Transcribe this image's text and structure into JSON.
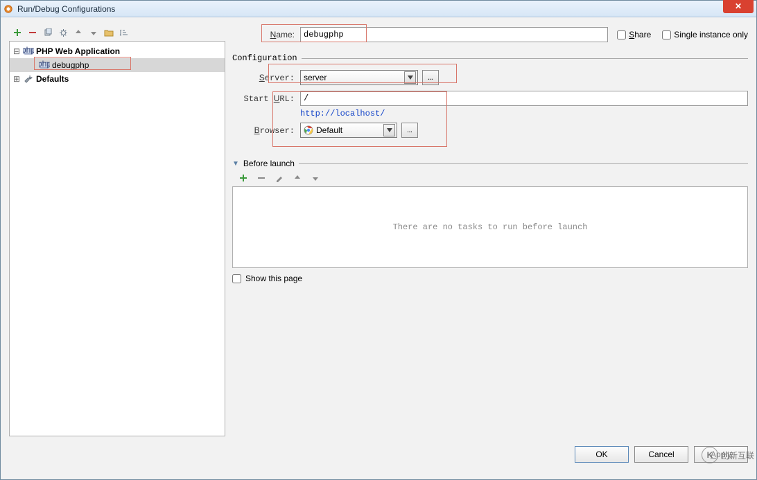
{
  "window": {
    "title": "Run/Debug Configurations"
  },
  "toolbar": {
    "icons": [
      "add",
      "remove",
      "copy",
      "wrench",
      "arrow-up",
      "arrow-down",
      "folder",
      "sort"
    ]
  },
  "tree": {
    "root": {
      "label": "PHP Web Application"
    },
    "child": {
      "label": "debugphp"
    },
    "defaults": {
      "label": "Defaults"
    }
  },
  "form": {
    "name_label": "Name:",
    "name_value": "debugphp",
    "share_label": "Share",
    "single_label": "Single instance only",
    "config_label": "Configuration",
    "server_label": "Server:",
    "server_value": "server",
    "start_url_label": "Start URL:",
    "start_url_value": "/",
    "url_display": "http://localhost/",
    "browser_label": "Browser:",
    "browser_value": "Default",
    "before_label": "Before launch",
    "tasks_placeholder": "There are no tasks to run before launch",
    "show_label": "Show this page"
  },
  "buttons": {
    "ok": "OK",
    "cancel": "Cancel",
    "apply": "Apply"
  },
  "watermark": "创新互联"
}
